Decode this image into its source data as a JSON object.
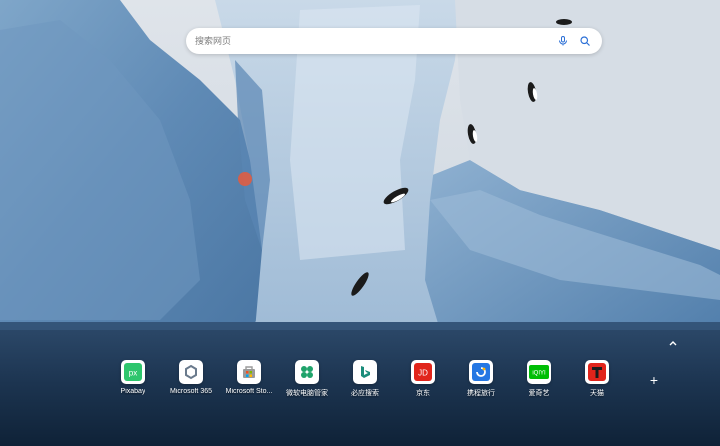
{
  "search": {
    "placeholder": "搜索网页"
  },
  "icons": {
    "voice": "microphone-icon",
    "search": "search-icon",
    "add": "plus-icon",
    "collapse": "chevron-up-icon"
  },
  "quick_links": [
    {
      "label": "Pixabay",
      "icon": "pixabay-icon",
      "color": "#2ec66d"
    },
    {
      "label": "Microsoft 365",
      "icon": "microsoft-365-icon",
      "color": "#6a7a8c"
    },
    {
      "label": "Microsoft Sto...",
      "icon": "microsoft-store-icon",
      "color": "#8c8c8c"
    },
    {
      "label": "微软电脑管家",
      "icon": "pc-manager-icon",
      "color": "#1fa36b"
    },
    {
      "label": "必应搜索",
      "icon": "bing-icon",
      "color": "#1a8c7a"
    },
    {
      "label": "京东",
      "icon": "jd-icon",
      "color": "#e1251b"
    },
    {
      "label": "携程旅行",
      "icon": "ctrip-icon",
      "color": "#2577e3"
    },
    {
      "label": "爱奇艺",
      "icon": "iqiyi-icon",
      "color": "#00be06"
    },
    {
      "label": "天猫",
      "icon": "tmall-icon",
      "color": "#e0241b"
    }
  ]
}
